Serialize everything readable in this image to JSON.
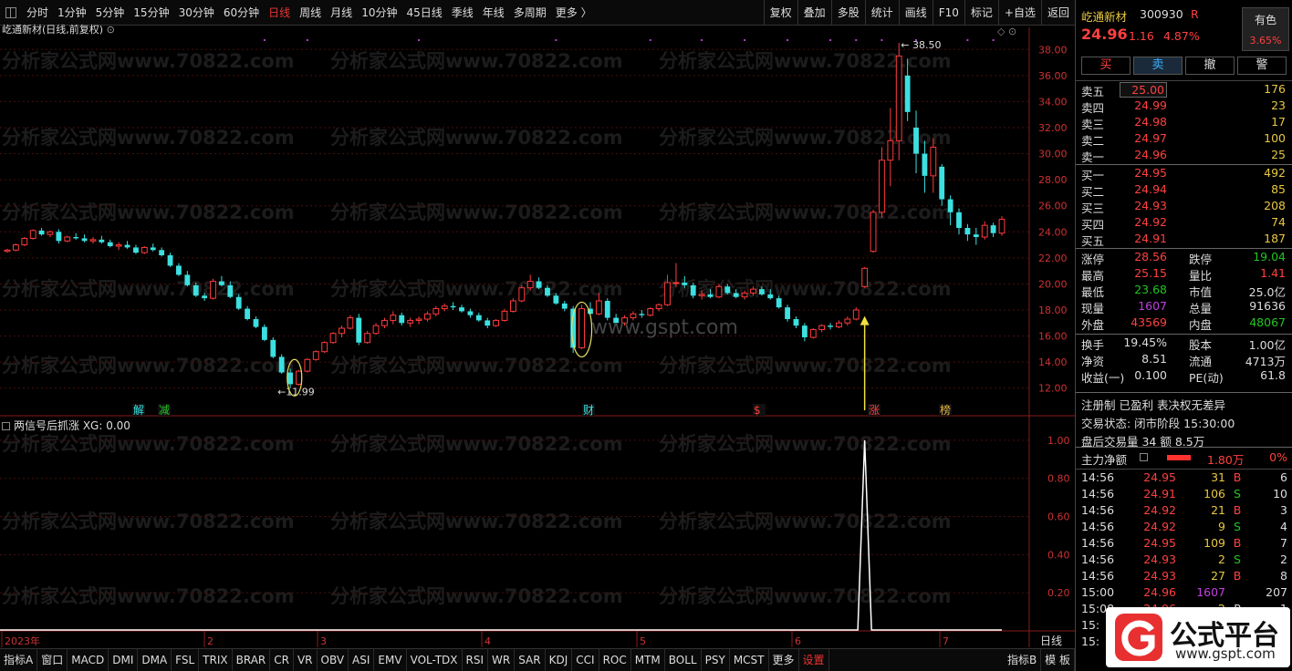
{
  "toolbar": {
    "tabs": [
      "分时",
      "1分钟",
      "5分钟",
      "15分钟",
      "30分钟",
      "60分钟",
      "日线",
      "周线",
      "月线",
      "10分钟",
      "45日线",
      "季线",
      "年线",
      "多周期",
      "更多 〉"
    ],
    "active": "日线",
    "right": [
      "复权",
      "叠加",
      "多股",
      "统计",
      "画线",
      "F10",
      "标记",
      "+自选",
      "返回"
    ]
  },
  "chart": {
    "title": "屹通新材(日线,前复权)",
    "lower_title": "两信号后抓涨  XG: 0.00",
    "high_label": "38.50",
    "low_label": "11.99",
    "y_ticks": [
      "38.00",
      "36.00",
      "34.00",
      "32.00",
      "30.00",
      "28.00",
      "26.00",
      "24.00",
      "22.00",
      "20.00",
      "18.00",
      "16.00",
      "14.00",
      "12.00"
    ],
    "lower_ticks": [
      "1.00",
      "0.80",
      "0.60",
      "0.40",
      "0.20"
    ],
    "x_labels": [
      "2023年",
      "2",
      "3",
      "4",
      "5",
      "6",
      "7"
    ],
    "right_tab": "日线",
    "markers": [
      "解",
      "减",
      "财",
      "$",
      "涨",
      "榜"
    ],
    "watermark": "分析家公式网www.70822.com",
    "watermark2": "www.gspt.com"
  },
  "chart_data": {
    "type": "candlestick",
    "ylim": [
      11,
      39
    ],
    "candles": [
      [
        22.5,
        22.7,
        22.4,
        22.6
      ],
      [
        22.6,
        23.1,
        22.5,
        23.0
      ],
      [
        23.0,
        23.6,
        22.9,
        23.5
      ],
      [
        23.5,
        24.2,
        23.4,
        24.1
      ],
      [
        24.1,
        24.3,
        23.7,
        23.8
      ],
      [
        23.8,
        24.1,
        23.6,
        24.0
      ],
      [
        24.0,
        24.2,
        23.1,
        23.3
      ],
      [
        23.3,
        23.7,
        23.2,
        23.6
      ],
      [
        23.6,
        23.9,
        23.4,
        23.5
      ],
      [
        23.5,
        23.8,
        23.2,
        23.3
      ],
      [
        23.3,
        23.6,
        23.1,
        23.4
      ],
      [
        23.4,
        23.7,
        23.1,
        23.2
      ],
      [
        23.2,
        23.4,
        22.8,
        22.9
      ],
      [
        22.9,
        23.2,
        22.6,
        23.0
      ],
      [
        23.0,
        23.3,
        22.7,
        22.8
      ],
      [
        22.8,
        23.0,
        22.3,
        22.4
      ],
      [
        22.4,
        22.9,
        22.3,
        22.8
      ],
      [
        22.8,
        23.1,
        22.5,
        22.6
      ],
      [
        22.6,
        22.8,
        22.1,
        22.2
      ],
      [
        22.2,
        22.4,
        21.3,
        21.4
      ],
      [
        21.4,
        21.6,
        20.6,
        20.7
      ],
      [
        20.7,
        21.0,
        19.8,
        19.9
      ],
      [
        19.9,
        20.1,
        19.0,
        19.1
      ],
      [
        19.1,
        19.3,
        18.7,
        18.9
      ],
      [
        18.9,
        20.4,
        18.8,
        20.2
      ],
      [
        20.2,
        20.6,
        19.8,
        19.9
      ],
      [
        19.9,
        20.2,
        18.9,
        19.0
      ],
      [
        19.0,
        19.2,
        18.0,
        18.1
      ],
      [
        18.1,
        18.3,
        17.2,
        17.3
      ],
      [
        17.3,
        17.5,
        16.6,
        16.7
      ],
      [
        16.7,
        16.9,
        15.6,
        15.7
      ],
      [
        15.7,
        15.9,
        14.3,
        14.4
      ],
      [
        14.4,
        14.6,
        13.1,
        13.2
      ],
      [
        13.2,
        13.5,
        12.0,
        12.3
      ],
      [
        12.3,
        13.4,
        12.2,
        13.3
      ],
      [
        13.3,
        14.3,
        13.2,
        14.2
      ],
      [
        14.2,
        14.9,
        14.1,
        14.8
      ],
      [
        14.8,
        15.6,
        14.7,
        15.5
      ],
      [
        15.5,
        16.3,
        15.4,
        16.2
      ],
      [
        16.2,
        16.8,
        15.9,
        16.6
      ],
      [
        16.6,
        17.6,
        16.5,
        17.4
      ],
      [
        17.4,
        17.7,
        15.3,
        15.5
      ],
      [
        15.5,
        16.4,
        15.4,
        16.2
      ],
      [
        16.2,
        17.0,
        16.1,
        16.8
      ],
      [
        16.8,
        17.4,
        16.6,
        17.2
      ],
      [
        17.2,
        17.9,
        16.9,
        17.6
      ],
      [
        17.6,
        17.8,
        16.8,
        17.0
      ],
      [
        17.0,
        17.4,
        16.7,
        17.2
      ],
      [
        17.2,
        17.5,
        16.9,
        17.3
      ],
      [
        17.3,
        17.9,
        17.1,
        17.7
      ],
      [
        17.7,
        18.3,
        17.5,
        18.1
      ],
      [
        18.1,
        18.5,
        17.9,
        18.3
      ],
      [
        18.3,
        18.6,
        18.0,
        18.2
      ],
      [
        18.2,
        18.4,
        17.8,
        17.9
      ],
      [
        17.9,
        18.1,
        17.4,
        17.6
      ],
      [
        17.6,
        17.8,
        17.1,
        17.2
      ],
      [
        17.2,
        17.4,
        16.6,
        16.8
      ],
      [
        16.8,
        17.3,
        16.7,
        17.2
      ],
      [
        17.2,
        18.1,
        17.1,
        17.9
      ],
      [
        17.9,
        18.9,
        17.8,
        18.7
      ],
      [
        18.7,
        19.9,
        18.6,
        19.7
      ],
      [
        19.7,
        20.7,
        19.5,
        20.2
      ],
      [
        20.2,
        20.5,
        19.6,
        19.7
      ],
      [
        19.7,
        19.9,
        19.0,
        19.1
      ],
      [
        19.1,
        19.3,
        18.4,
        18.5
      ],
      [
        18.5,
        18.7,
        17.9,
        18.1
      ],
      [
        18.1,
        18.3,
        14.7,
        15.1
      ],
      [
        15.1,
        18.4,
        15.0,
        18.1
      ],
      [
        18.1,
        18.6,
        17.5,
        17.7
      ],
      [
        17.7,
        19.3,
        17.6,
        18.7
      ],
      [
        18.7,
        18.9,
        17.2,
        17.4
      ],
      [
        17.4,
        17.7,
        16.8,
        17.0
      ],
      [
        17.0,
        17.6,
        16.8,
        17.4
      ],
      [
        17.4,
        17.9,
        17.2,
        17.7
      ],
      [
        17.7,
        18.0,
        17.4,
        17.6
      ],
      [
        17.6,
        18.2,
        17.5,
        18.1
      ],
      [
        18.1,
        18.5,
        17.9,
        18.4
      ],
      [
        18.4,
        20.7,
        18.3,
        20.1
      ],
      [
        20.1,
        21.6,
        19.8,
        20.1
      ],
      [
        20.1,
        20.6,
        19.7,
        19.9
      ],
      [
        19.9,
        20.1,
        18.9,
        19.1
      ],
      [
        19.1,
        19.5,
        18.8,
        19.2
      ],
      [
        19.2,
        19.6,
        18.9,
        19.0
      ],
      [
        19.0,
        20.0,
        18.9,
        19.8
      ],
      [
        19.8,
        20.0,
        19.2,
        19.3
      ],
      [
        19.3,
        19.6,
        18.9,
        19.0
      ],
      [
        19.0,
        19.5,
        18.8,
        19.3
      ],
      [
        19.3,
        19.8,
        19.1,
        19.6
      ],
      [
        19.6,
        19.8,
        19.1,
        19.2
      ],
      [
        19.2,
        19.6,
        18.8,
        18.9
      ],
      [
        18.9,
        19.1,
        18.1,
        18.2
      ],
      [
        18.2,
        18.4,
        17.1,
        17.3
      ],
      [
        17.3,
        17.5,
        16.6,
        16.8
      ],
      [
        16.8,
        17.0,
        15.6,
        15.9
      ],
      [
        15.9,
        16.6,
        15.8,
        16.5
      ],
      [
        16.5,
        16.9,
        16.3,
        16.8
      ],
      [
        16.8,
        17.0,
        16.5,
        16.7
      ],
      [
        16.7,
        17.2,
        16.6,
        17.0
      ],
      [
        17.0,
        17.5,
        16.8,
        17.3
      ],
      [
        17.3,
        18.2,
        17.2,
        18.0
      ],
      [
        19.8,
        21.3,
        19.7,
        21.2
      ],
      [
        22.5,
        25.7,
        22.4,
        25.5
      ],
      [
        25.5,
        30.5,
        25.1,
        29.5
      ],
      [
        29.5,
        33.5,
        27.5,
        31.0
      ],
      [
        31.0,
        38.5,
        29.5,
        37.5
      ],
      [
        36.0,
        37.3,
        32.5,
        33.2
      ],
      [
        32.0,
        33.3,
        28.5,
        30.0
      ],
      [
        30.0,
        31.0,
        27.0,
        28.3
      ],
      [
        28.3,
        31.2,
        27.0,
        30.5
      ],
      [
        29.0,
        29.2,
        26.0,
        26.5
      ],
      [
        26.5,
        26.8,
        24.5,
        25.5
      ],
      [
        25.5,
        25.8,
        23.8,
        24.3
      ],
      [
        24.3,
        24.6,
        23.3,
        23.8
      ],
      [
        23.8,
        24.3,
        23.0,
        23.6
      ],
      [
        23.6,
        24.8,
        23.4,
        24.5
      ],
      [
        24.5,
        24.7,
        23.6,
        23.9
      ],
      [
        23.9,
        25.2,
        23.7,
        24.96
      ]
    ],
    "lower_series": [
      0,
      1,
      0
    ],
    "lower_ylim": [
      0,
      1.1
    ]
  },
  "quote": {
    "name": "屹通新材",
    "code": "300930",
    "badge": "R",
    "price": "24.96",
    "change": "1.16",
    "pct": "4.87%",
    "own": "有色",
    "own_pct": "3.65%"
  },
  "buttons": [
    "买",
    "卖",
    "撤",
    "警"
  ],
  "asks": [
    [
      "卖五",
      "25.00",
      "176"
    ],
    [
      "卖四",
      "24.99",
      "23"
    ],
    [
      "卖三",
      "24.98",
      "17"
    ],
    [
      "卖二",
      "24.97",
      "100"
    ],
    [
      "卖一",
      "24.96",
      "25"
    ]
  ],
  "bids": [
    [
      "买一",
      "24.95",
      "492"
    ],
    [
      "买二",
      "24.94",
      "85"
    ],
    [
      "买三",
      "24.93",
      "208"
    ],
    [
      "买四",
      "24.92",
      "74"
    ],
    [
      "买五",
      "24.91",
      "187"
    ]
  ],
  "stats": [
    [
      "涨停",
      "28.56",
      "跌停",
      "19.04"
    ],
    [
      "最高",
      "25.15",
      "量比",
      "1.41"
    ],
    [
      "最低",
      "23.68",
      "市值",
      "25.0亿"
    ],
    [
      "现量",
      "1607",
      "总量",
      "91636"
    ],
    [
      "外盘",
      "43569",
      "内盘",
      "48067"
    ],
    [
      "换手",
      "19.45%",
      "股本",
      "1.00亿"
    ],
    [
      "净资",
      "8.51",
      "流通",
      "4713万"
    ],
    [
      "收益(一)",
      "0.100",
      "PE(动)",
      "61.8"
    ]
  ],
  "notes": [
    "注册制 已盈利 表决权无差异",
    "交易状态: 闭市阶段 15:30:00",
    "盘后交易量 34 额 8.5万"
  ],
  "capital": {
    "label": "主力净额",
    "value": "1.80万",
    "pct": "0%"
  },
  "ticks": [
    [
      "14:56",
      "24.95",
      "31",
      "B",
      "6"
    ],
    [
      "14:56",
      "24.91",
      "106",
      "S",
      "10"
    ],
    [
      "14:56",
      "24.92",
      "21",
      "B",
      "3"
    ],
    [
      "14:56",
      "24.92",
      "9",
      "S",
      "4"
    ],
    [
      "14:56",
      "24.95",
      "109",
      "B",
      "7"
    ],
    [
      "14:56",
      "24.93",
      "2",
      "S",
      "2"
    ],
    [
      "14:56",
      "24.93",
      "27",
      "B",
      "8"
    ],
    [
      "15:00",
      "24.96",
      "1607",
      "",
      "207"
    ],
    [
      "15:08",
      "24.96",
      "2",
      "P",
      "1"
    ],
    [
      "15:",
      "",
      "",
      "",
      ""
    ],
    [
      "15:",
      "",
      "",
      "",
      ""
    ]
  ],
  "bottom": {
    "tabs": [
      "指标A",
      "窗口",
      "MACD",
      "DMI",
      "DMA",
      "FSL",
      "TRIX",
      "BRAR",
      "CR",
      "VR",
      "OBV",
      "ASI",
      "EMV",
      "VOL-TDX",
      "RSI",
      "WR",
      "SAR",
      "KDJ",
      "CCI",
      "ROC",
      "MTM",
      "BOLL",
      "PSY",
      "MCST",
      "更多",
      "设置"
    ],
    "right": [
      "指标B",
      "模 板"
    ]
  },
  "logo": {
    "text": "公式平台",
    "url": "www.gspt.com"
  }
}
